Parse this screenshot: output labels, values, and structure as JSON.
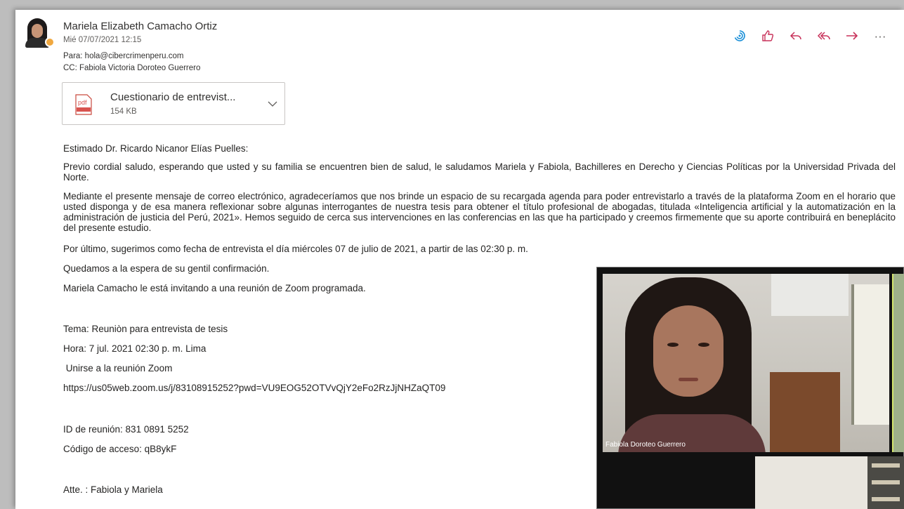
{
  "message": {
    "sender": "Mariela Elizabeth Camacho Ortiz",
    "date": "Mié 07/07/2021 12:15",
    "to": "Para:  hola@cibercrimenperu.com",
    "cc": "CC:  Fabiola Victoria Doroteo Guerrero"
  },
  "actions": [
    {
      "name": "insights-icon"
    },
    {
      "name": "like-icon"
    },
    {
      "name": "reply-icon"
    },
    {
      "name": "reply-all-icon"
    },
    {
      "name": "forward-icon"
    },
    {
      "name": "more-icon",
      "glyph": "···"
    }
  ],
  "attachment": {
    "filename": "Cuestionario de entrevist...",
    "size": "154 KB",
    "type_label": "pdf"
  },
  "body": {
    "greeting": "Estimado Dr. Ricardo Nicanor Elías Puelles:",
    "para1": "Previo cordial saludo, esperando que usted y su familia se encuentren bien de salud, le saludamos Mariela y Fabiola, Bachilleres en Derecho y Ciencias Políticas por la Universidad Privada del Norte.",
    "para2": "Mediante el presente mensaje de correo electrónico, agradeceríamos que nos brinde un espacio de su recargada agenda para poder entrevistarlo a través de la plataforma Zoom en el horario que usted disponga y de esa manera reflexionar sobre algunas interrogantes de nuestra tesis para obtener el título profesional de abogadas, titulada «Inteligencia artificial y la automatización en la administración de justicia del Perú, 2021». Hemos seguido de cerca sus intervenciones en las conferencias en las que ha participado y creemos firmemente que su aporte contribuirá en beneplácito del presente estudio.",
    "para3": "Por último, sugerimos como fecha de entrevista el día miércoles 07 de julio de 2021, a partir de las 02:30 p. m.",
    "para4": "Quedamos a la espera de su gentil confirmación.",
    "para5": "Mariela Camacho le está invitando a una reunión de Zoom programada.",
    "topic": "Tema: Reuniòn para entrevista de tesis",
    "time": "Hora: 7 jul. 2021 02:30 p. m. Lima",
    "join": " Unirse a la reunión Zoom",
    "link": "https://us05web.zoom.us/j/83108915252?pwd=VU9EOG52OTVvQjY2eFo2RzJjNHZaQT09",
    "meeting_id": "ID de reunión: 831 0891 5252",
    "passcode": "Código de acceso: qB8ykF",
    "signature": "Atte. : Fabiola y Mariela"
  },
  "video": {
    "participant_name": "Fabiola Doroteo Guerrero"
  },
  "colors": {
    "accent": "#c8325a",
    "pdf": "#d9534f"
  }
}
